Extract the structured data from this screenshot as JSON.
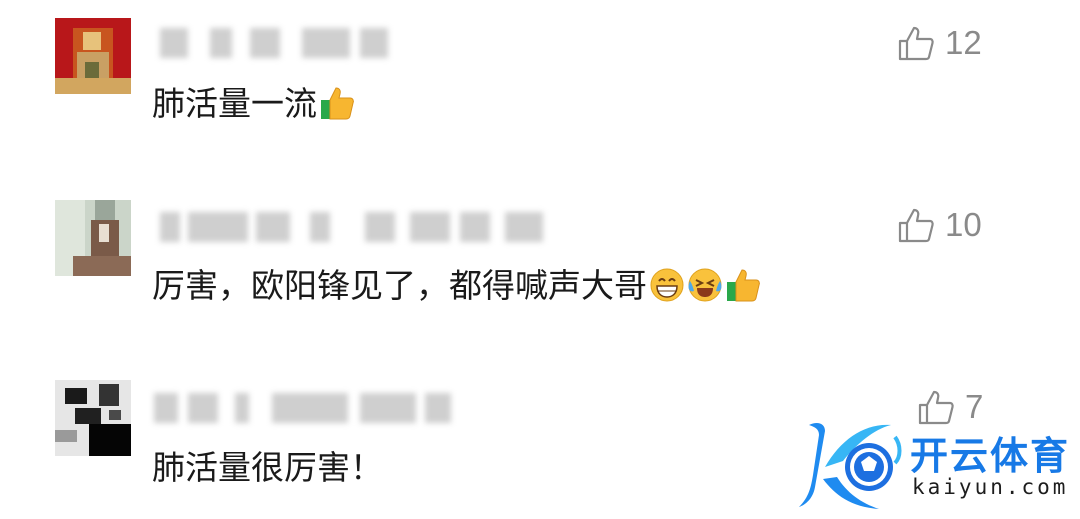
{
  "comments": [
    {
      "text": "肺活量一流",
      "emojis": [
        "thumbs-up"
      ],
      "likes": "12"
    },
    {
      "text": "厉害，欧阳锋见了，都得喊声大哥",
      "emojis": [
        "grinning-face",
        "crying-laughing-face",
        "thumbs-up"
      ],
      "likes": "10"
    },
    {
      "text": "肺活量很厉害！",
      "emojis": [],
      "likes": "7"
    }
  ],
  "watermark": {
    "name": "开云体育",
    "url": "kaiyun.com"
  },
  "colors": {
    "like_gray": "#8a8a8a",
    "brand_blue": "#1779e6"
  }
}
